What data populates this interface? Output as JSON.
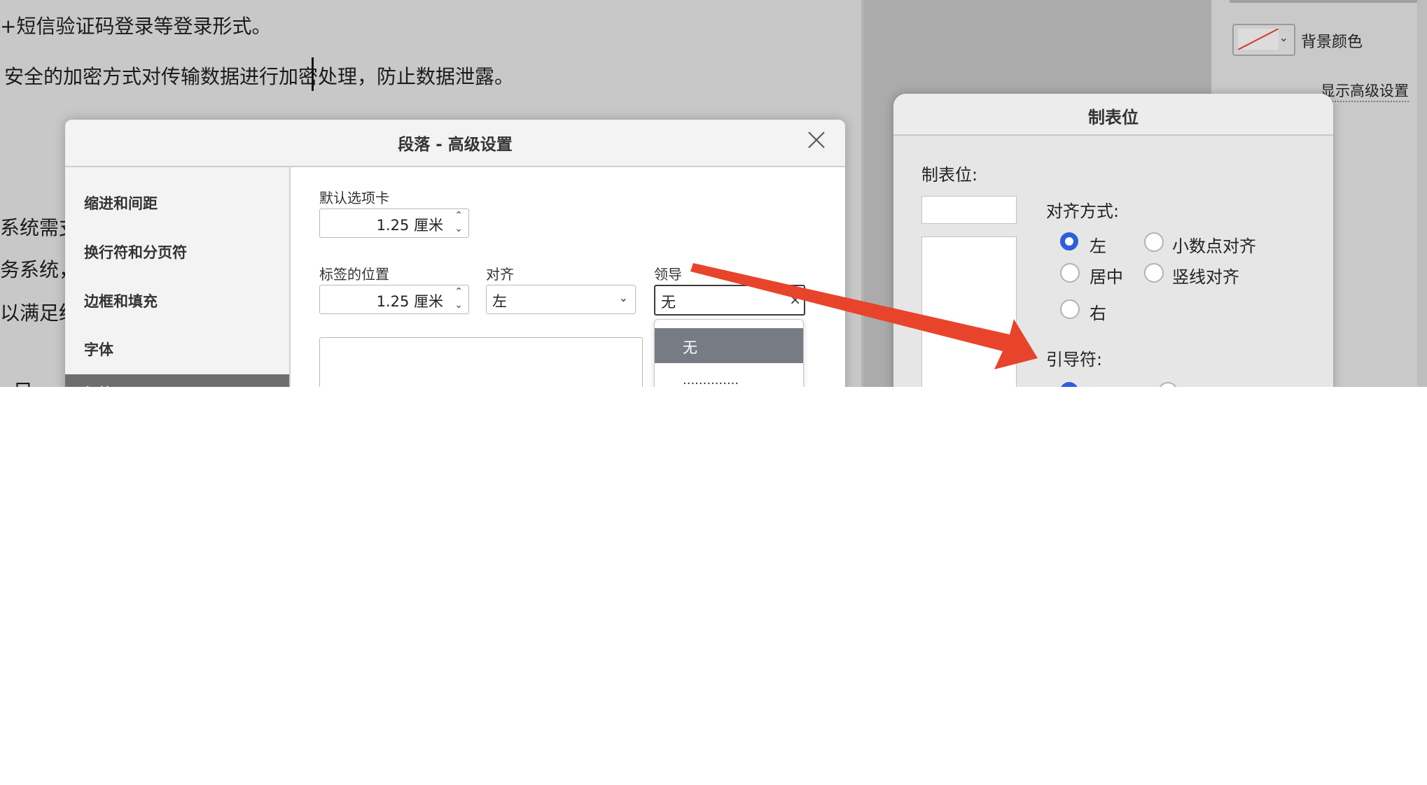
{
  "document": {
    "line1": "+短信验证码登录等登录形式。",
    "line2": "安全的加密方式对传输数据进行加密处理，防止数据泄露。",
    "left_fragments": [
      "系统需支",
      "务系统，",
      "以满足统",
      "- 目"
    ]
  },
  "right_panel": {
    "background_color_label": "背景颜色",
    "show_advanced_label": "显示高级设置",
    "color_swatch": "none (diagonal red line)"
  },
  "paragraph_dialog": {
    "title": "段落 - 高级设置",
    "close_icon": "close-icon",
    "sidebar": {
      "items": [
        {
          "label": "缩进和间距"
        },
        {
          "label": "换行符和分页符"
        },
        {
          "label": "边框和填充"
        },
        {
          "label": "字体"
        },
        {
          "label": "标签"
        }
      ]
    },
    "default_tab": {
      "label": "默认选项卡",
      "value": "1.25 厘米"
    },
    "tab_position": {
      "label": "标签的位置",
      "value": "1.25 厘米"
    },
    "alignment": {
      "label": "对齐",
      "value": "左"
    },
    "leader": {
      "label": "领导",
      "value": "无",
      "clear_icon": "×"
    },
    "leader_dropdown": {
      "options": [
        {
          "label": "无",
          "selected": true
        },
        {
          "label": "..............",
          "selected": false
        }
      ]
    }
  },
  "tab_dialog": {
    "title": "制表位",
    "tab_stop_label": "制表位:",
    "alignment_label": "对齐方式:",
    "alignment_options": [
      {
        "label": "左",
        "selected": true
      },
      {
        "label": "小数点对齐",
        "selected": false
      },
      {
        "label": "居中",
        "selected": false
      },
      {
        "label": "竖线对齐",
        "selected": false
      },
      {
        "label": "右",
        "selected": false
      }
    ],
    "leader_label": "引导符:"
  },
  "colors": {
    "annotation_arrow": "#e8442b",
    "radio_selected": "#2c5fdc",
    "dropdown_selected_bg": "#777c84"
  }
}
